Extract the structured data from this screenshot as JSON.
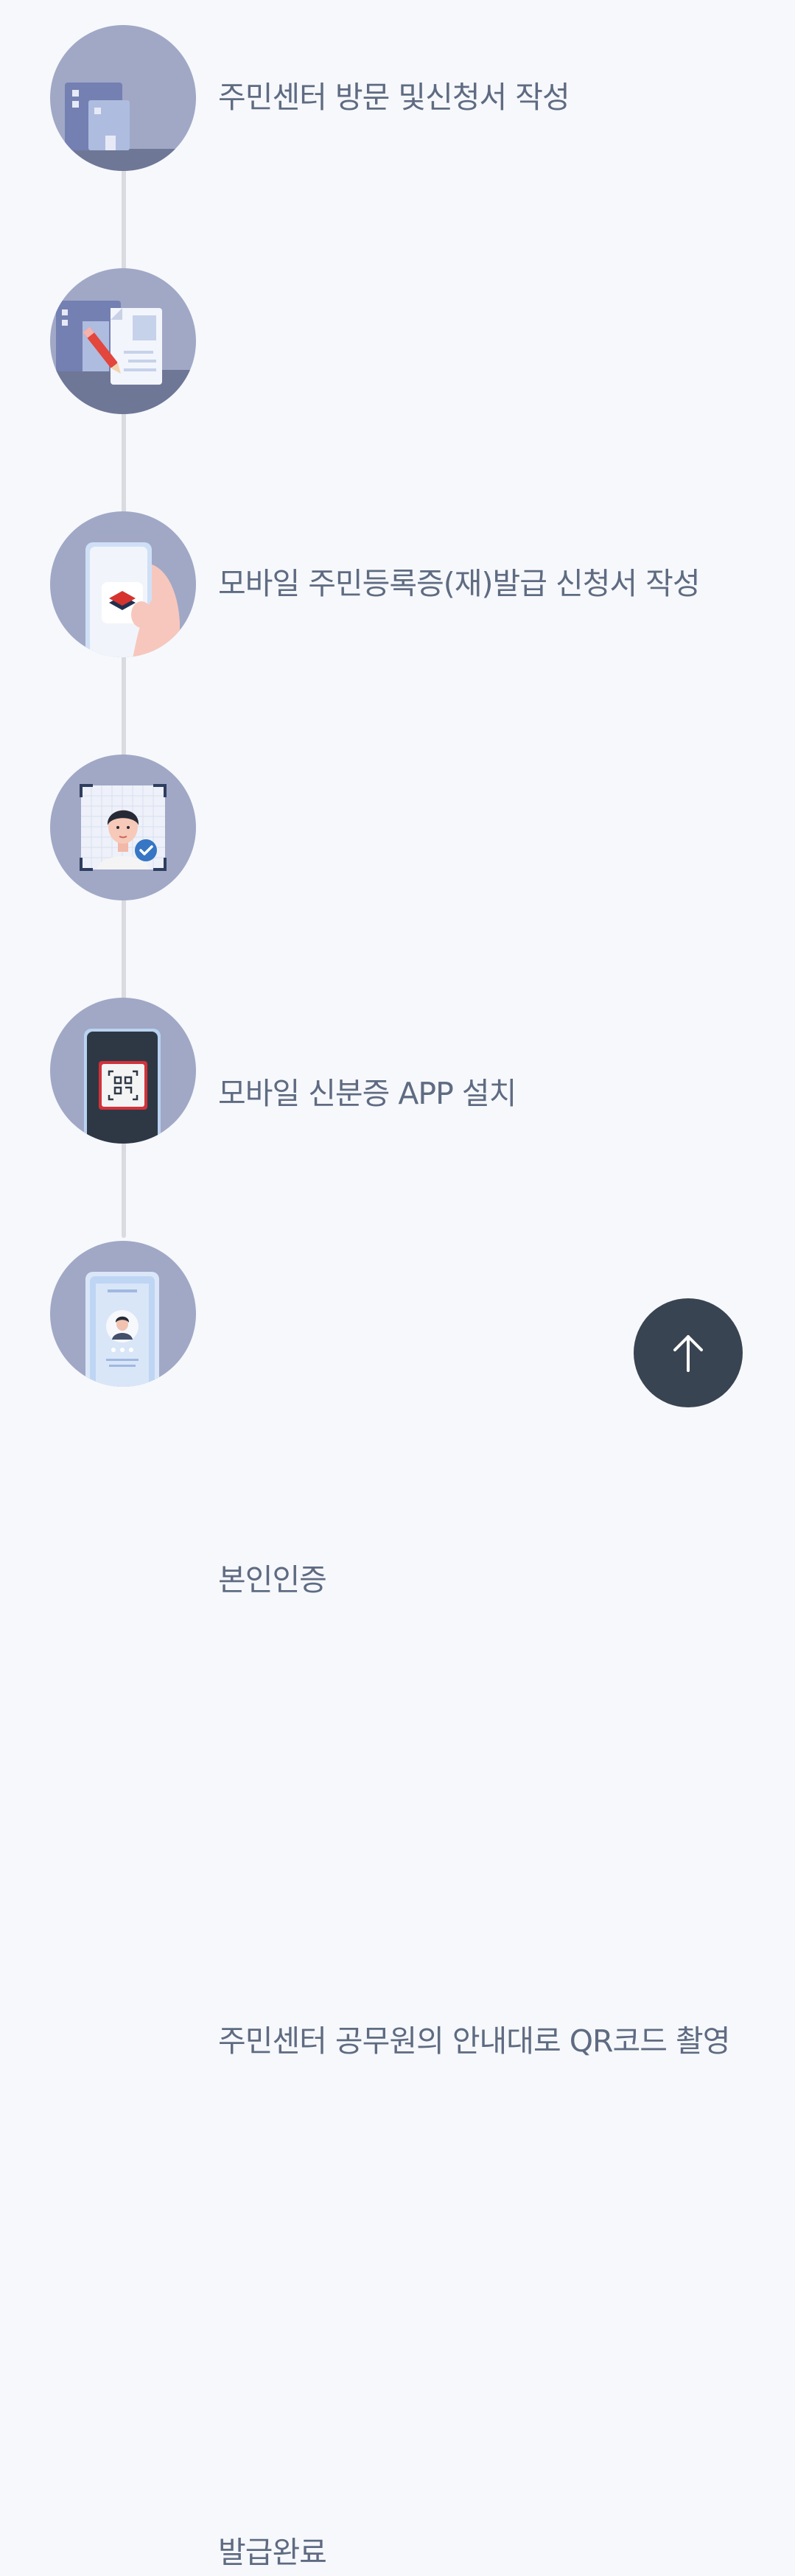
{
  "steps": [
    {
      "label": "주민센터 방문 및신청서 작성",
      "icon": "building-icon"
    },
    {
      "label": "모바일 주민등록증(재)발급 신청서 작성",
      "icon": "application-form-icon"
    },
    {
      "label": "모바일 신분증 APP 설치",
      "icon": "phone-app-icon"
    },
    {
      "label": "본인인증",
      "icon": "identity-verification-icon"
    },
    {
      "label": "주민센터 공무원의 안내대로 QR코드 촬영",
      "icon": "qr-scan-icon"
    },
    {
      "label": "발급완료",
      "icon": "mobile-id-card-icon"
    }
  ],
  "colors": {
    "background": "#f7f8fb",
    "circle": "#a0a8c6",
    "line": "#d9dbe1",
    "label": "#5e6b82",
    "scroll_top_button": "#394452"
  },
  "scroll_top": {
    "icon": "arrow-up-icon"
  }
}
